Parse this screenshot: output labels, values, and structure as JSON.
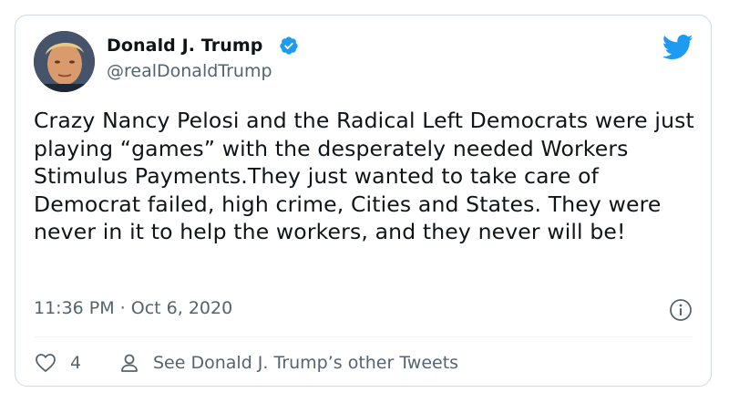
{
  "author": {
    "name": "Donald J. Trump",
    "handle": "@realDonaldTrump",
    "verified": true
  },
  "tweet": {
    "text": "Crazy Nancy Pelosi and the Radical Left Democrats were just playing “games” with the desperately needed Workers Stimulus Payments.They just wanted to take care of Democrat failed, high crime, Cities and States. They were never in it to help the workers, and they never will be!",
    "timestamp": "11:36 PM · Oct 6, 2020"
  },
  "actions": {
    "like_count": "4",
    "other_tweets_label": "See Donald J. Trump’s other Tweets"
  },
  "colors": {
    "brand": "#1d9bf0",
    "secondary_text": "#536471",
    "border": "#cfd9de"
  },
  "icons": [
    "avatar",
    "verified-badge-icon",
    "twitter-bird-icon",
    "info-icon",
    "heart-icon",
    "person-icon"
  ]
}
